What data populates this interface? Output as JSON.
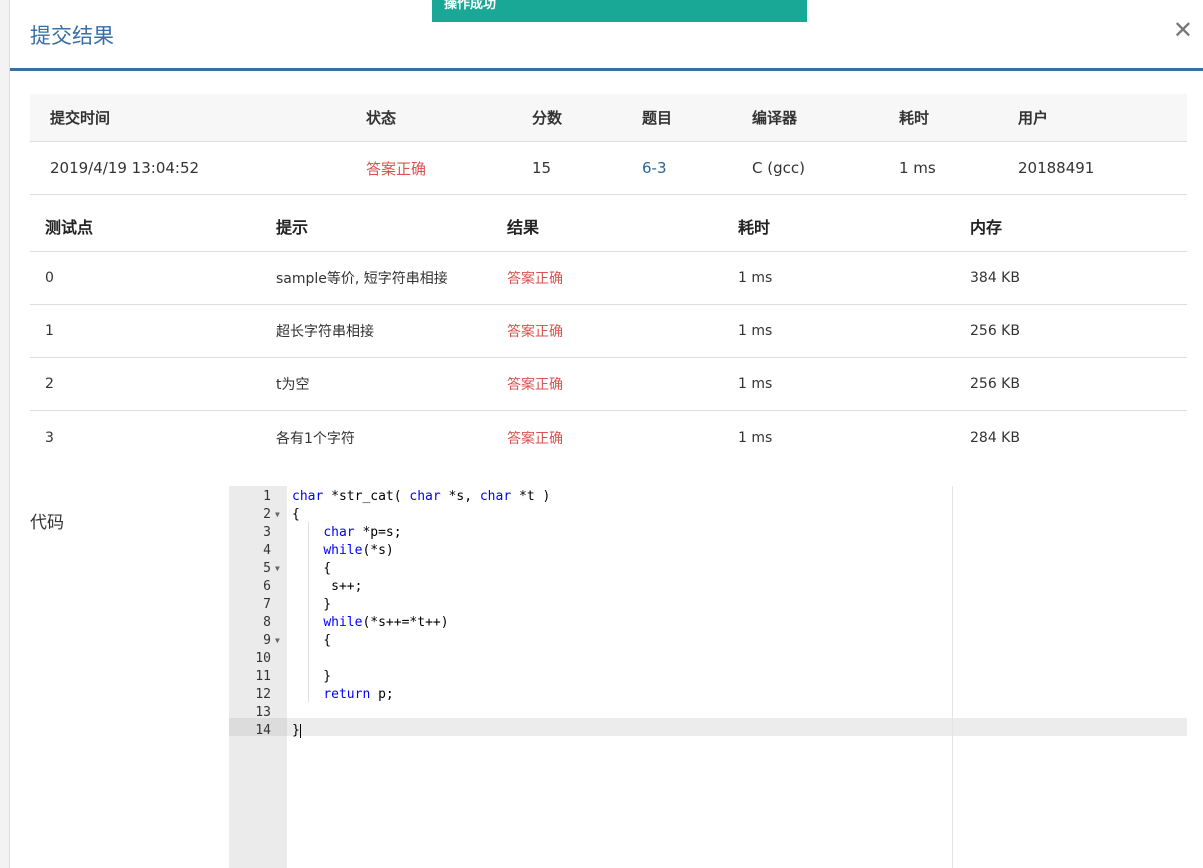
{
  "toast": {
    "text": "操作成功"
  },
  "modal": {
    "title": "提交结果",
    "close_icon": "close-icon"
  },
  "summary": {
    "headers": [
      "提交时间",
      "状态",
      "分数",
      "题目",
      "编译器",
      "耗时",
      "用户"
    ],
    "row": {
      "time": "2019/4/19 13:04:52",
      "status": "答案正确",
      "score": "15",
      "problem": "6-3",
      "compiler": "C (gcc)",
      "elapsed": "1 ms",
      "user": "20188491"
    }
  },
  "tests": {
    "headers": [
      "测试点",
      "提示",
      "结果",
      "耗时",
      "内存"
    ],
    "rows": [
      {
        "id": "0",
        "hint": "sample等价, 短字符串相接",
        "result": "答案正确",
        "time": "1 ms",
        "memory": "384 KB"
      },
      {
        "id": "1",
        "hint": "超长字符串相接",
        "result": "答案正确",
        "time": "1 ms",
        "memory": "256 KB"
      },
      {
        "id": "2",
        "hint": "t为空",
        "result": "答案正确",
        "time": "1 ms",
        "memory": "256 KB"
      },
      {
        "id": "3",
        "hint": "各有1个字符",
        "result": "答案正确",
        "time": "1 ms",
        "memory": "284 KB"
      }
    ]
  },
  "code": {
    "label": "代码",
    "lines": [
      "char *str_cat( char *s, char *t )",
      "{",
      "    char *p=s;",
      "    while(*s)",
      "    {",
      "     s++;",
      "    }",
      "    while(*s++=*t++)",
      "    {",
      "    ",
      "    }",
      "    return p;",
      "",
      "}"
    ],
    "fold_lines": [
      2,
      5,
      9
    ],
    "active_line": 14
  },
  "colors": {
    "accent": "#3a6fa5",
    "success": "#d9534f",
    "toast": "#1aa896",
    "link": "#2a6496"
  }
}
